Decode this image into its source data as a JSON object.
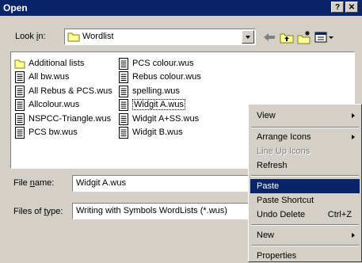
{
  "window": {
    "title": "Open",
    "help_label": "?",
    "close_label": "✕"
  },
  "lookin": {
    "label_pre": "Look ",
    "label_u": "i",
    "label_post": "n:",
    "value": "Wordlist"
  },
  "files": [
    {
      "name": "Additional lists",
      "type": "folder"
    },
    {
      "name": "All bw.wus",
      "type": "file"
    },
    {
      "name": "All Rebus & PCS.wus",
      "type": "file"
    },
    {
      "name": "Allcolour.wus",
      "type": "file"
    },
    {
      "name": "NSPCC-Triangle.wus",
      "type": "file"
    },
    {
      "name": "PCS bw.wus",
      "type": "file"
    },
    {
      "name": "PCS colour.wus",
      "type": "file"
    },
    {
      "name": "Rebus colour.wus",
      "type": "file"
    },
    {
      "name": "spelling.wus",
      "type": "file"
    },
    {
      "name": "Widgit A.wus",
      "type": "file",
      "selected": true
    },
    {
      "name": "Widgit A+SS.wus",
      "type": "file"
    },
    {
      "name": "Widgit B.wus",
      "type": "file"
    }
  ],
  "filename": {
    "label_pre": "File ",
    "label_u": "n",
    "label_post": "ame:",
    "value": "Widgit A.wus"
  },
  "filetype": {
    "label_pre": "Files of ",
    "label_u": "t",
    "label_post": "ype:",
    "value": "Writing with Symbols WordLists (*.wus)"
  },
  "context_menu": {
    "view": "View",
    "arrange_icons": "Arrange Icons",
    "line_up_icons": "Line Up Icons",
    "refresh": "Refresh",
    "paste": "Paste",
    "paste_shortcut": "Paste Shortcut",
    "undo_delete": "Undo Delete",
    "undo_shortcut": "Ctrl+Z",
    "new": "New",
    "properties": "Properties"
  }
}
